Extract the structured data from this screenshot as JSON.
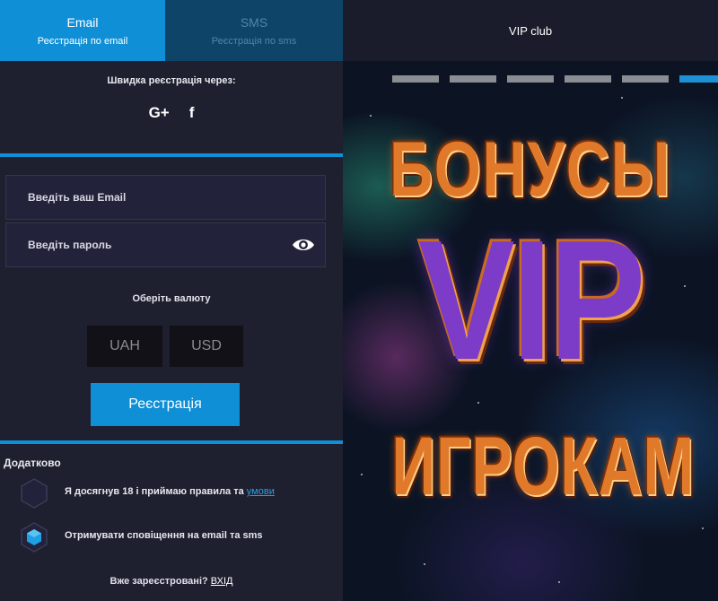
{
  "tabs": [
    {
      "title": "Email",
      "subtitle": "Реєстрація по email"
    },
    {
      "title": "SMS",
      "subtitle": "Реєстрація по sms"
    }
  ],
  "quick_reg": {
    "label": "Швидка реєстрація через:",
    "google_icon_text": "G+",
    "facebook_icon_text": "f"
  },
  "form": {
    "email_placeholder": "Введіть ваш Email",
    "password_placeholder": "Введіть пароль",
    "currency_label": "Оберіть валюту",
    "currencies": [
      "UAH",
      "USD"
    ],
    "register_button": "Реєстрація"
  },
  "extra": {
    "title": "Додатково",
    "terms_text": "Я досягнув 18 і приймаю правила та ",
    "terms_link": "умови",
    "notifications_text": "Отримувати сповіщення на email та sms"
  },
  "login": {
    "question": "Вже зареєстровані? ",
    "link": "ВХІД"
  },
  "right": {
    "title": "VIP club",
    "banner_line1": "БОНУСЫ",
    "banner_line2": "VIP",
    "banner_line3": "ИГРОКАМ"
  },
  "colors": {
    "accent": "#0f8fd6",
    "tab_inactive": "#0d4468",
    "panel_bg": "#1e1f2f",
    "link": "#2d9fe0"
  }
}
